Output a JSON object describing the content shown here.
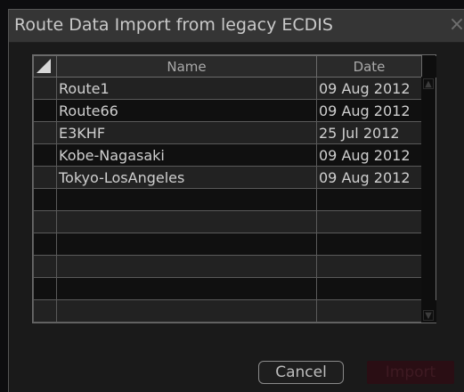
{
  "dialog": {
    "title": "Route Data Import from legacy ECDIS",
    "close_symbol": "×"
  },
  "table": {
    "columns": {
      "name": "Name",
      "date": "Date"
    },
    "rows": [
      {
        "name": "Route1",
        "date": "09 Aug 2012"
      },
      {
        "name": "Route66",
        "date": "09 Aug 2012"
      },
      {
        "name": "E3KHF",
        "date": "25 Jul 2012"
      },
      {
        "name": "Kobe-Nagasaki",
        "date": "09 Aug 2012"
      },
      {
        "name": "Tokyo-LosAngeles",
        "date": "09 Aug 2012"
      },
      {
        "name": "",
        "date": ""
      },
      {
        "name": "",
        "date": ""
      },
      {
        "name": "",
        "date": ""
      },
      {
        "name": "",
        "date": ""
      },
      {
        "name": "",
        "date": ""
      },
      {
        "name": "",
        "date": ""
      }
    ]
  },
  "buttons": {
    "cancel": "Cancel",
    "import": "Import"
  },
  "colors": {
    "accent_disabled": "#2a0e14"
  }
}
